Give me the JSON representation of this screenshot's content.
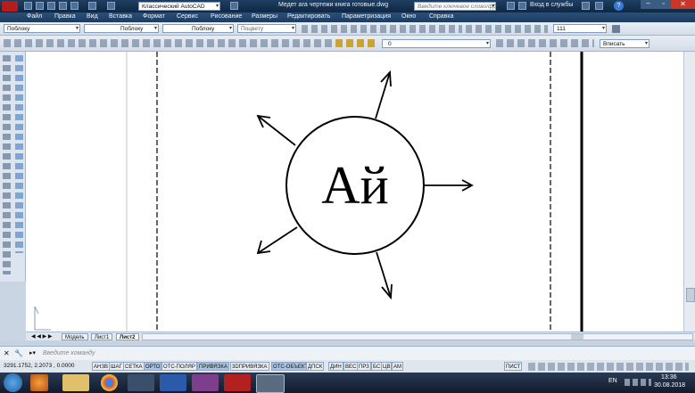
{
  "window": {
    "workspace": "Классический AutoCAD",
    "doc_title": "Медет ага чертежи книга готовые.dwg",
    "search_placeholder": "Введите ключевое слово/фразу",
    "signin": "Вход в службы"
  },
  "menu": [
    "Файл",
    "Правка",
    "Вид",
    "Вставка",
    "Формат",
    "Сервис",
    "Рисование",
    "Размеры",
    "Редактировать",
    "Параметризация",
    "Окно",
    "Справка"
  ],
  "properties": {
    "layer": "Поблоку",
    "linetype": "Поблоку",
    "lineweight": "Поблоку",
    "plotstyle": "Поцвету",
    "scale": "111"
  },
  "layers": {
    "current": "0",
    "zoom": "Вписать"
  },
  "drawing": {
    "text": "Ай"
  },
  "tabs": [
    "Модель",
    "Лист1",
    "Лист2"
  ],
  "command": {
    "placeholder": "Введите команду"
  },
  "status": {
    "coords": "3291.1752, 2.2073 , 0.0000",
    "toggles": [
      {
        "label": "АНЗВ",
        "on": false
      },
      {
        "label": "ШАГ",
        "on": false
      },
      {
        "label": "СЕТКА",
        "on": false
      },
      {
        "label": "ОРТО",
        "on": true
      },
      {
        "label": "ОТС-ПОЛЯР",
        "on": false
      },
      {
        "label": "ПРИВЯЗКА",
        "on": true
      },
      {
        "label": "3DПРИВЯЗКА",
        "on": false
      },
      {
        "label": "ОТС-ОБЪЕКТ",
        "on": true
      },
      {
        "label": "ДПСК",
        "on": false
      },
      {
        "label": "ДИН",
        "on": false
      },
      {
        "label": "ВЕС",
        "on": false
      },
      {
        "label": "ПРЗ",
        "on": false
      },
      {
        "label": "БС",
        "on": false
      },
      {
        "label": "ЦВ",
        "on": false
      },
      {
        "label": "АМ",
        "on": false
      }
    ],
    "space": "ПИСТ"
  },
  "taskbar": {
    "lang": "EN",
    "time": "13:36",
    "date": "30.08.2018"
  }
}
